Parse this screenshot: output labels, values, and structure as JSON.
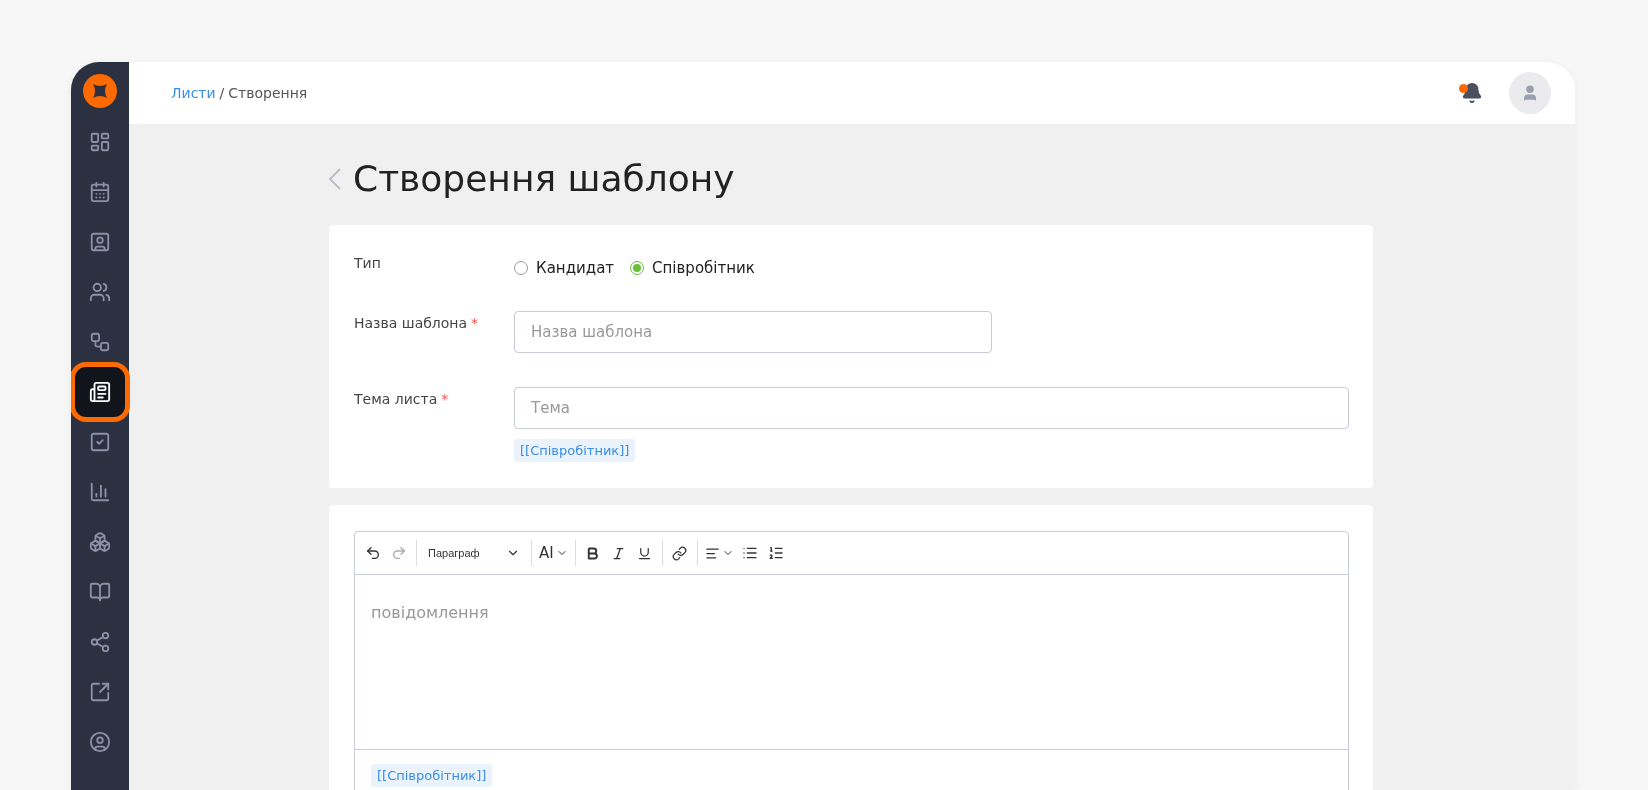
{
  "sidebar": {
    "items": [
      {
        "selected": false
      },
      {
        "selected": false
      },
      {
        "selected": false
      },
      {
        "selected": false
      },
      {
        "selected": false
      },
      {
        "selected": true
      },
      {
        "selected": false
      },
      {
        "selected": false
      },
      {
        "selected": false
      },
      {
        "selected": false
      },
      {
        "selected": false
      },
      {
        "selected": false
      },
      {
        "selected": false
      }
    ]
  },
  "breadcrumb": {
    "link": "Листи",
    "separator": "/",
    "current": "Створення"
  },
  "notification": {
    "unread": true
  },
  "page_title": "Створення шаблону",
  "form": {
    "type": {
      "label": "Тип",
      "options": [
        {
          "label": "Кандидат",
          "selected": false
        },
        {
          "label": "Співробітник",
          "selected": true
        }
      ]
    },
    "name": {
      "label": "Назва шаблона",
      "required_mark": "*",
      "placeholder": "Назва шаблона"
    },
    "subject": {
      "label": "Тема листа",
      "required_mark": "*",
      "placeholder": "Тема",
      "variables": [
        "[[Співробітник]]"
      ]
    }
  },
  "editor": {
    "paragraph_select": "Параграф",
    "font_size": "AI",
    "placeholder": "повідомлення",
    "variables": [
      "[[Співробітник]]"
    ]
  }
}
